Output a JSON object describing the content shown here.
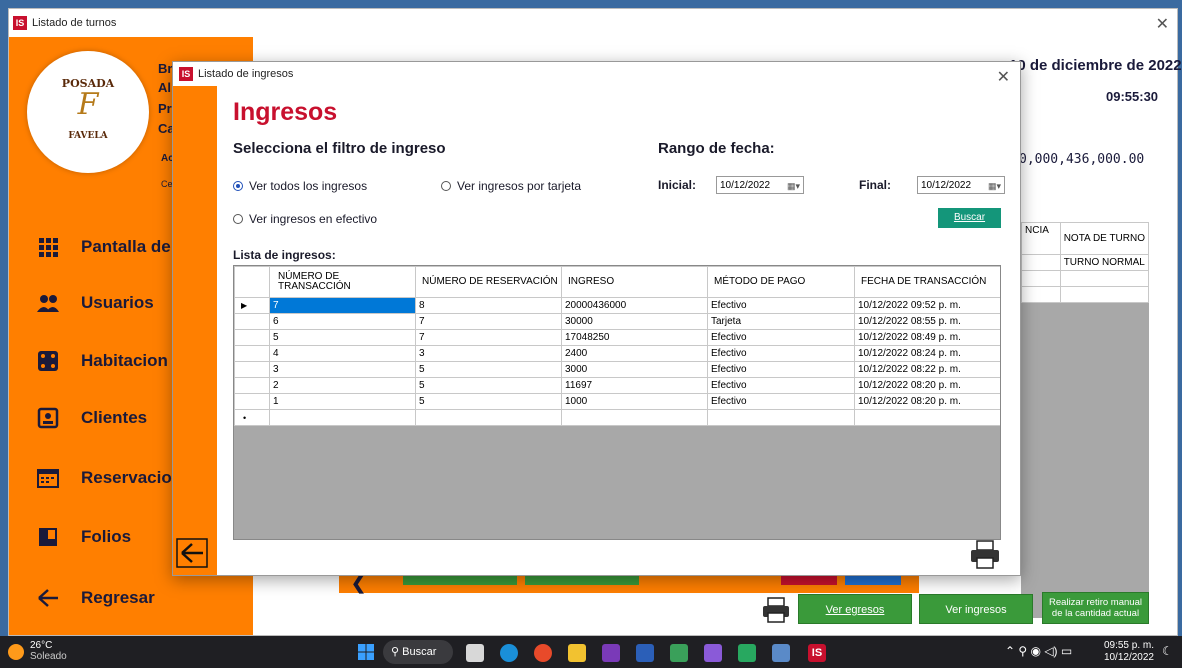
{
  "main_window": {
    "title": "Listado de turnos",
    "date_text": "10 de diciembre de 2022",
    "time_text": "09:55:30",
    "amount_text": "0,000,436,000.00",
    "business_lines": [
      "Br",
      "Al",
      "Pr",
      "Ca",
      "Ac",
      "Ce"
    ],
    "logo_text_top": "POSADA",
    "logo_letter": "F",
    "logo_text_bottom": "FAVELA",
    "right_table": {
      "headers": [
        "NCIA",
        "NOTA DE TURNO"
      ],
      "rows": [
        [
          "",
          "TURNO NORMAL"
        ],
        [
          "",
          ""
        ],
        [
          "",
          ""
        ]
      ]
    },
    "buttons": {
      "egresos": "Ver egresos",
      "ingresos": "Ver ingresos",
      "retiro": "Realizar retiro manual de la cantidad actual"
    }
  },
  "sidebar": {
    "items": [
      {
        "label": "Pantalla de",
        "icon": "grid-icon"
      },
      {
        "label": "Usuarios",
        "icon": "users-icon"
      },
      {
        "label": "Habitacion",
        "icon": "dice-icon"
      },
      {
        "label": "Clientes",
        "icon": "id-card-icon"
      },
      {
        "label": "Reservacio",
        "icon": "calendar-icon"
      },
      {
        "label": "Folios",
        "icon": "folder-icon"
      },
      {
        "label": "Regresar",
        "icon": "arrow-left-icon"
      }
    ]
  },
  "dialog": {
    "title": "Listado de ingresos",
    "heading": "Ingresos",
    "filter_title": "Selecciona el filtro de ingreso",
    "radio_all": "Ver todos los ingresos",
    "radio_card": "Ver ingresos por tarjeta",
    "radio_cash": "Ver ingresos en efectivo",
    "date_range_title": "Rango de fecha:",
    "initial_label": "Inicial:",
    "initial_value": "10/12/2022",
    "final_label": "Final:",
    "final_value": "10/12/2022",
    "search_button": "Buscar",
    "list_label": "Lista de ingresos:",
    "columns": [
      "NÚMERO DE TRANSACCIÓN",
      "NÚMERO DE RESERVACIÓN",
      "INGRESO",
      "MÉTODO DE PAGO",
      "FECHA DE TRANSACCIÓN"
    ],
    "rows": [
      [
        "7",
        "8",
        "20000436000",
        "Efectivo",
        "10/12/2022 09:52 p. m."
      ],
      [
        "6",
        "7",
        "30000",
        "Tarjeta",
        "10/12/2022 08:55 p. m."
      ],
      [
        "5",
        "7",
        "17048250",
        "Efectivo",
        "10/12/2022 08:49 p. m."
      ],
      [
        "4",
        "3",
        "2400",
        "Efectivo",
        "10/12/2022 08:24 p. m."
      ],
      [
        "3",
        "5",
        "3000",
        "Efectivo",
        "10/12/2022 08:22 p. m."
      ],
      [
        "2",
        "5",
        "11697",
        "Efectivo",
        "10/12/2022 08:20 p. m."
      ],
      [
        "1",
        "5",
        "1000",
        "Efectivo",
        "10/12/2022 08:20 p. m."
      ]
    ]
  },
  "taskbar": {
    "temp": "26°C",
    "weather": "Soleado",
    "search": "Buscar",
    "time": "09:55 p. m.",
    "date": "10/12/2022"
  },
  "colors": {
    "orange": "#ff7f00",
    "heading_red": "#c8102e",
    "green": "#3a9a3a"
  }
}
